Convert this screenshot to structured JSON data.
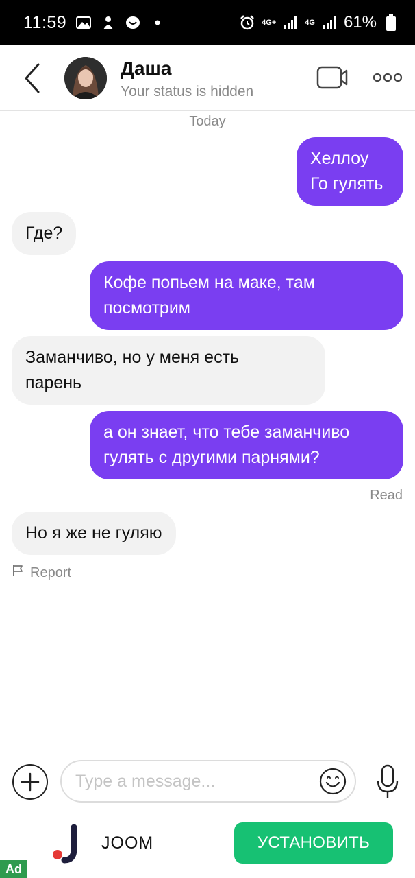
{
  "status_bar": {
    "time": "11:59",
    "network_a": "4G+",
    "network_b": "4G",
    "battery": "61%",
    "icons": [
      "gallery-icon",
      "app-icon",
      "messenger-icon",
      "dot-icon",
      "alarm-icon",
      "signal-icon",
      "signal-icon",
      "battery-icon"
    ]
  },
  "header": {
    "contact_name": "Даша",
    "contact_status": "Your status is hidden",
    "icons": [
      "back-arrow-icon",
      "video-call-icon",
      "more-options-icon"
    ]
  },
  "conversation": {
    "date_label": "Today",
    "messages": [
      {
        "direction": "outgoing",
        "text": "Хеллоу\nГо гулять"
      },
      {
        "direction": "incoming",
        "text": "Где?"
      },
      {
        "direction": "outgoing",
        "text": "Кофе попьем на маке, там\nпосмотрим"
      },
      {
        "direction": "incoming",
        "text": "Заманчиво, но у меня есть\nпарень"
      },
      {
        "direction": "outgoing",
        "text": "а он знает, что тебе заманчиво\nгулять с другими парнями?"
      },
      {
        "direction": "incoming",
        "text": "Но я же не гуляю"
      }
    ],
    "read_receipt": "Read",
    "report_label": "Report"
  },
  "composer": {
    "placeholder": "Type a message...",
    "icons": [
      "add-attachment-icon",
      "emoji-icon",
      "microphone-icon"
    ]
  },
  "ad": {
    "brand": "JOOM",
    "install_label": "УСТАНОВИТЬ",
    "badge": "Ad",
    "colors": {
      "button": "#17c173",
      "badge": "#2e9b4e",
      "logo_accent": "#e53935"
    }
  },
  "colors": {
    "outgoing_bubble": "#7a3ef1",
    "incoming_bubble": "#f2f2f2"
  }
}
